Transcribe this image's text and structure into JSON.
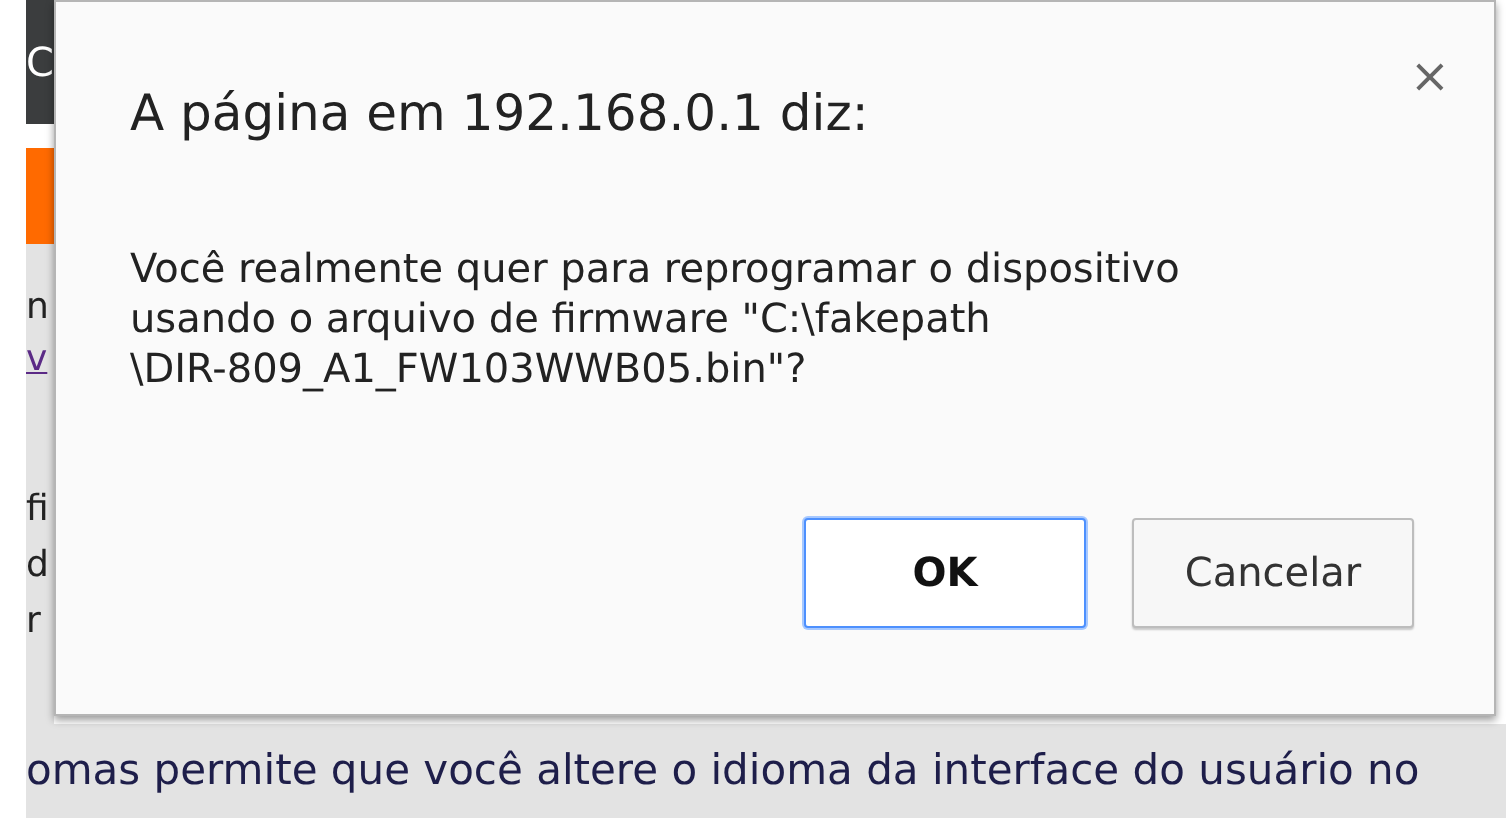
{
  "background_page": {
    "header_fragment": "C",
    "fragments": [
      {
        "text": "n",
        "kind": "text"
      },
      {
        "text": "v",
        "kind": "link"
      }
    ],
    "fragments_lower": [
      "fi",
      "d",
      "r"
    ],
    "bottom_text": "omas permite que você altere o idioma da interface do usuário no"
  },
  "dialog": {
    "title": "A página em 192.168.0.1 diz:",
    "close": "×",
    "message_lines": [
      "Você realmente quer para reprogramar o dispositivo",
      "usando o arquivo de firmware \"C:\\fakepath",
      "\\DIR-809_A1_FW103WWB05.bin\"?"
    ],
    "buttons": [
      {
        "label": "OK",
        "selected": true
      },
      {
        "label": "Cancelar",
        "selected": false
      }
    ]
  }
}
